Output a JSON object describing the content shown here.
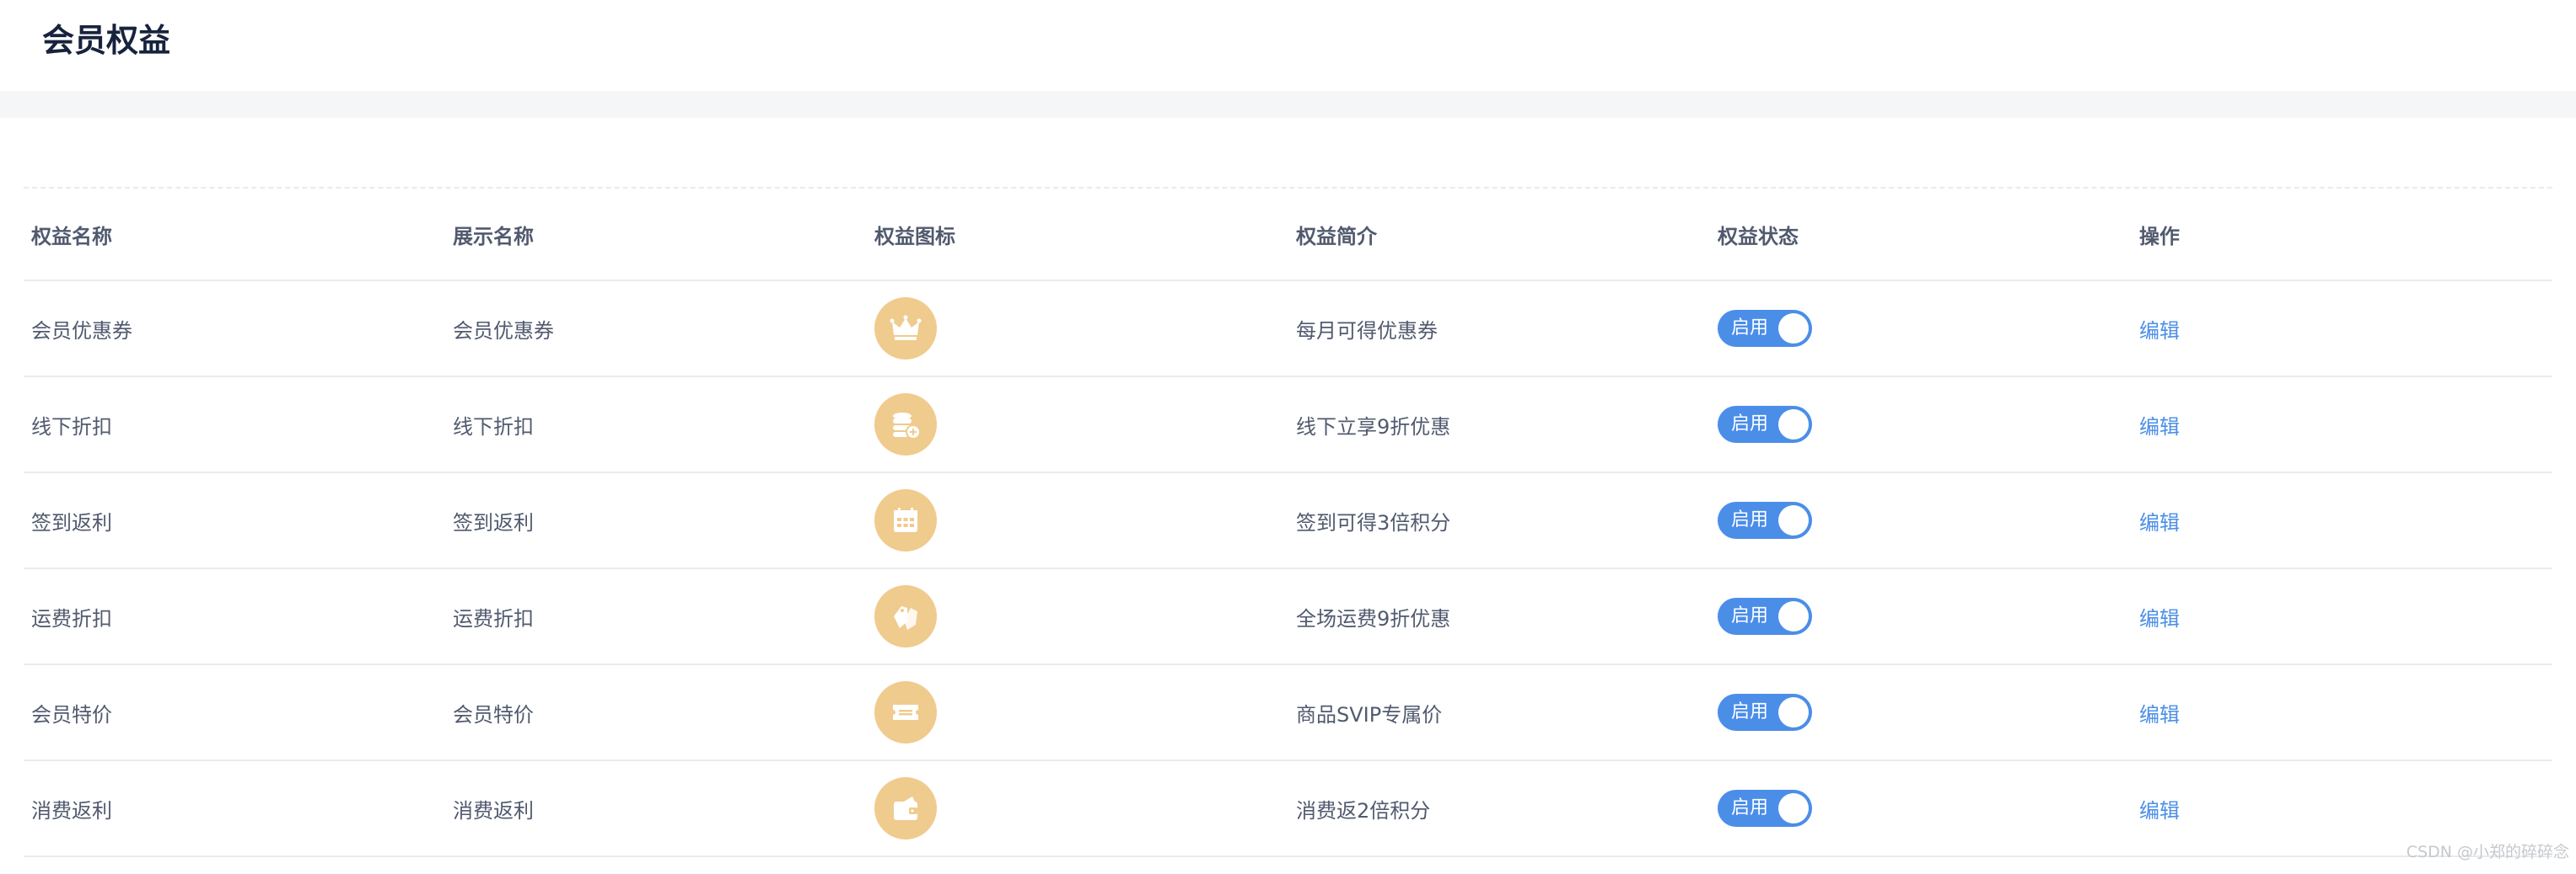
{
  "page": {
    "title": "会员权益"
  },
  "table": {
    "columns": [
      "权益名称",
      "展示名称",
      "权益图标",
      "权益简介",
      "权益状态",
      "操作"
    ],
    "rows": [
      {
        "name": "会员优惠券",
        "display_name": "会员优惠券",
        "icon": "crown-icon",
        "description": "每月可得优惠券",
        "status": "启用",
        "enabled": true,
        "action": "编辑"
      },
      {
        "name": "线下折扣",
        "display_name": "线下折扣",
        "icon": "coins-icon",
        "description": "线下立享9折优惠",
        "status": "启用",
        "enabled": true,
        "action": "编辑"
      },
      {
        "name": "签到返利",
        "display_name": "签到返利",
        "icon": "calendar-icon",
        "description": "签到可得3倍积分",
        "status": "启用",
        "enabled": true,
        "action": "编辑"
      },
      {
        "name": "运费折扣",
        "display_name": "运费折扣",
        "icon": "tags-icon",
        "description": "全场运费9折优惠",
        "status": "启用",
        "enabled": true,
        "action": "编辑"
      },
      {
        "name": "会员特价",
        "display_name": "会员特价",
        "icon": "ticket-icon",
        "description": "商品SVIP专属价",
        "status": "启用",
        "enabled": true,
        "action": "编辑"
      },
      {
        "name": "消费返利",
        "display_name": "消费返利",
        "icon": "wallet-icon",
        "description": "消费返2倍积分",
        "status": "启用",
        "enabled": true,
        "action": "编辑"
      }
    ]
  },
  "watermark": "CSDN @小郑的碎碎念",
  "colors": {
    "accent": "#4a8ee8",
    "icon_bg": "#efcb8e",
    "band": "#f5f6f8"
  }
}
